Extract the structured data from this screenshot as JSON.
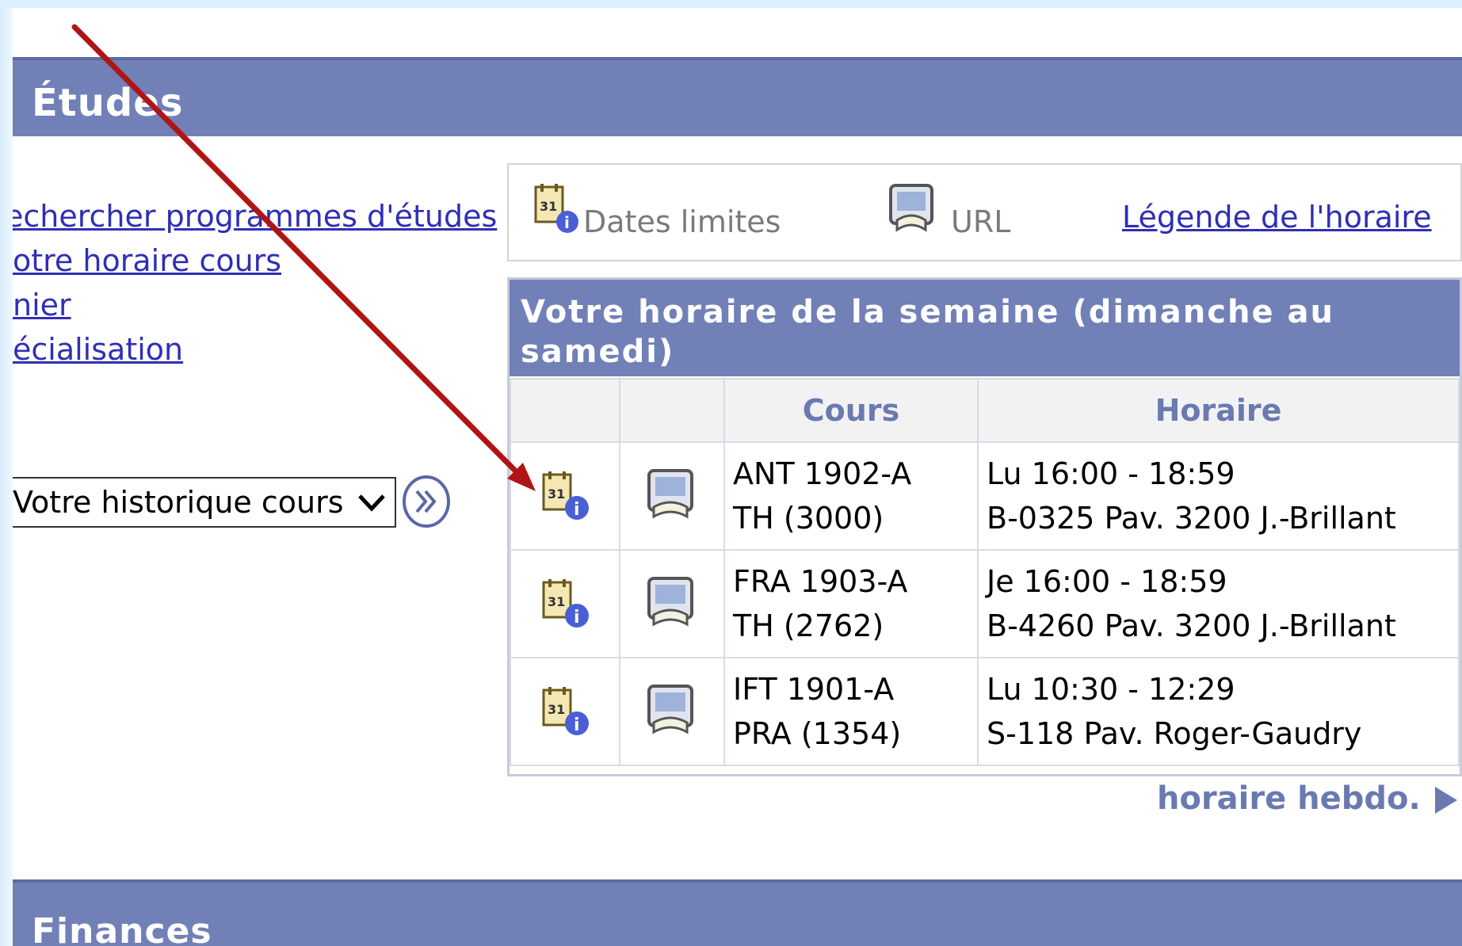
{
  "sections": {
    "etudes_title": "Études",
    "finances_title": "Finances"
  },
  "left_links": [
    {
      "label": "echercher programmes d'études"
    },
    {
      "label": "otre horaire cours"
    },
    {
      "label": "nier"
    },
    {
      "label": "écialisation"
    }
  ],
  "history_select": {
    "selected": "Votre historique cours"
  },
  "toolbar": {
    "dates_label": "Dates limites",
    "url_label": "URL",
    "legend_link": "Légende de l'horaire"
  },
  "schedule": {
    "title_line1": "Votre horaire de la semaine (dimanche au",
    "title_line2": "samedi)",
    "columns": [
      "",
      "",
      "Cours",
      "Horaire"
    ],
    "rows": [
      {
        "course_line1": "ANT 1902-A",
        "course_line2": "TH (3000)",
        "time": "Lu 16:00 - 18:59",
        "location": "B-0325  Pav. 3200 J.-Brillant"
      },
      {
        "course_line1": "FRA 1903-A",
        "course_line2": "TH (2762)",
        "time": "Je 16:00 - 18:59",
        "location": "B-4260  Pav. 3200 J.-Brillant"
      },
      {
        "course_line1": "IFT 1901-A",
        "course_line2": "PRA (1354)",
        "time": "Lu 10:30 - 12:29",
        "location": "S-118 Pav. Roger-Gaudry"
      }
    ],
    "weekly_link": "horaire hebdo."
  },
  "colors": {
    "header_bg": "#7180b7",
    "link": "#2f2fb6",
    "column_header_text": "#6a7ab1",
    "annotation_arrow": "#b01515"
  },
  "icons": {
    "deadline": "calendar-info-icon",
    "url": "book-url-icon",
    "go": "double-chevron-right-icon",
    "weekly": "triangle-right-icon"
  }
}
